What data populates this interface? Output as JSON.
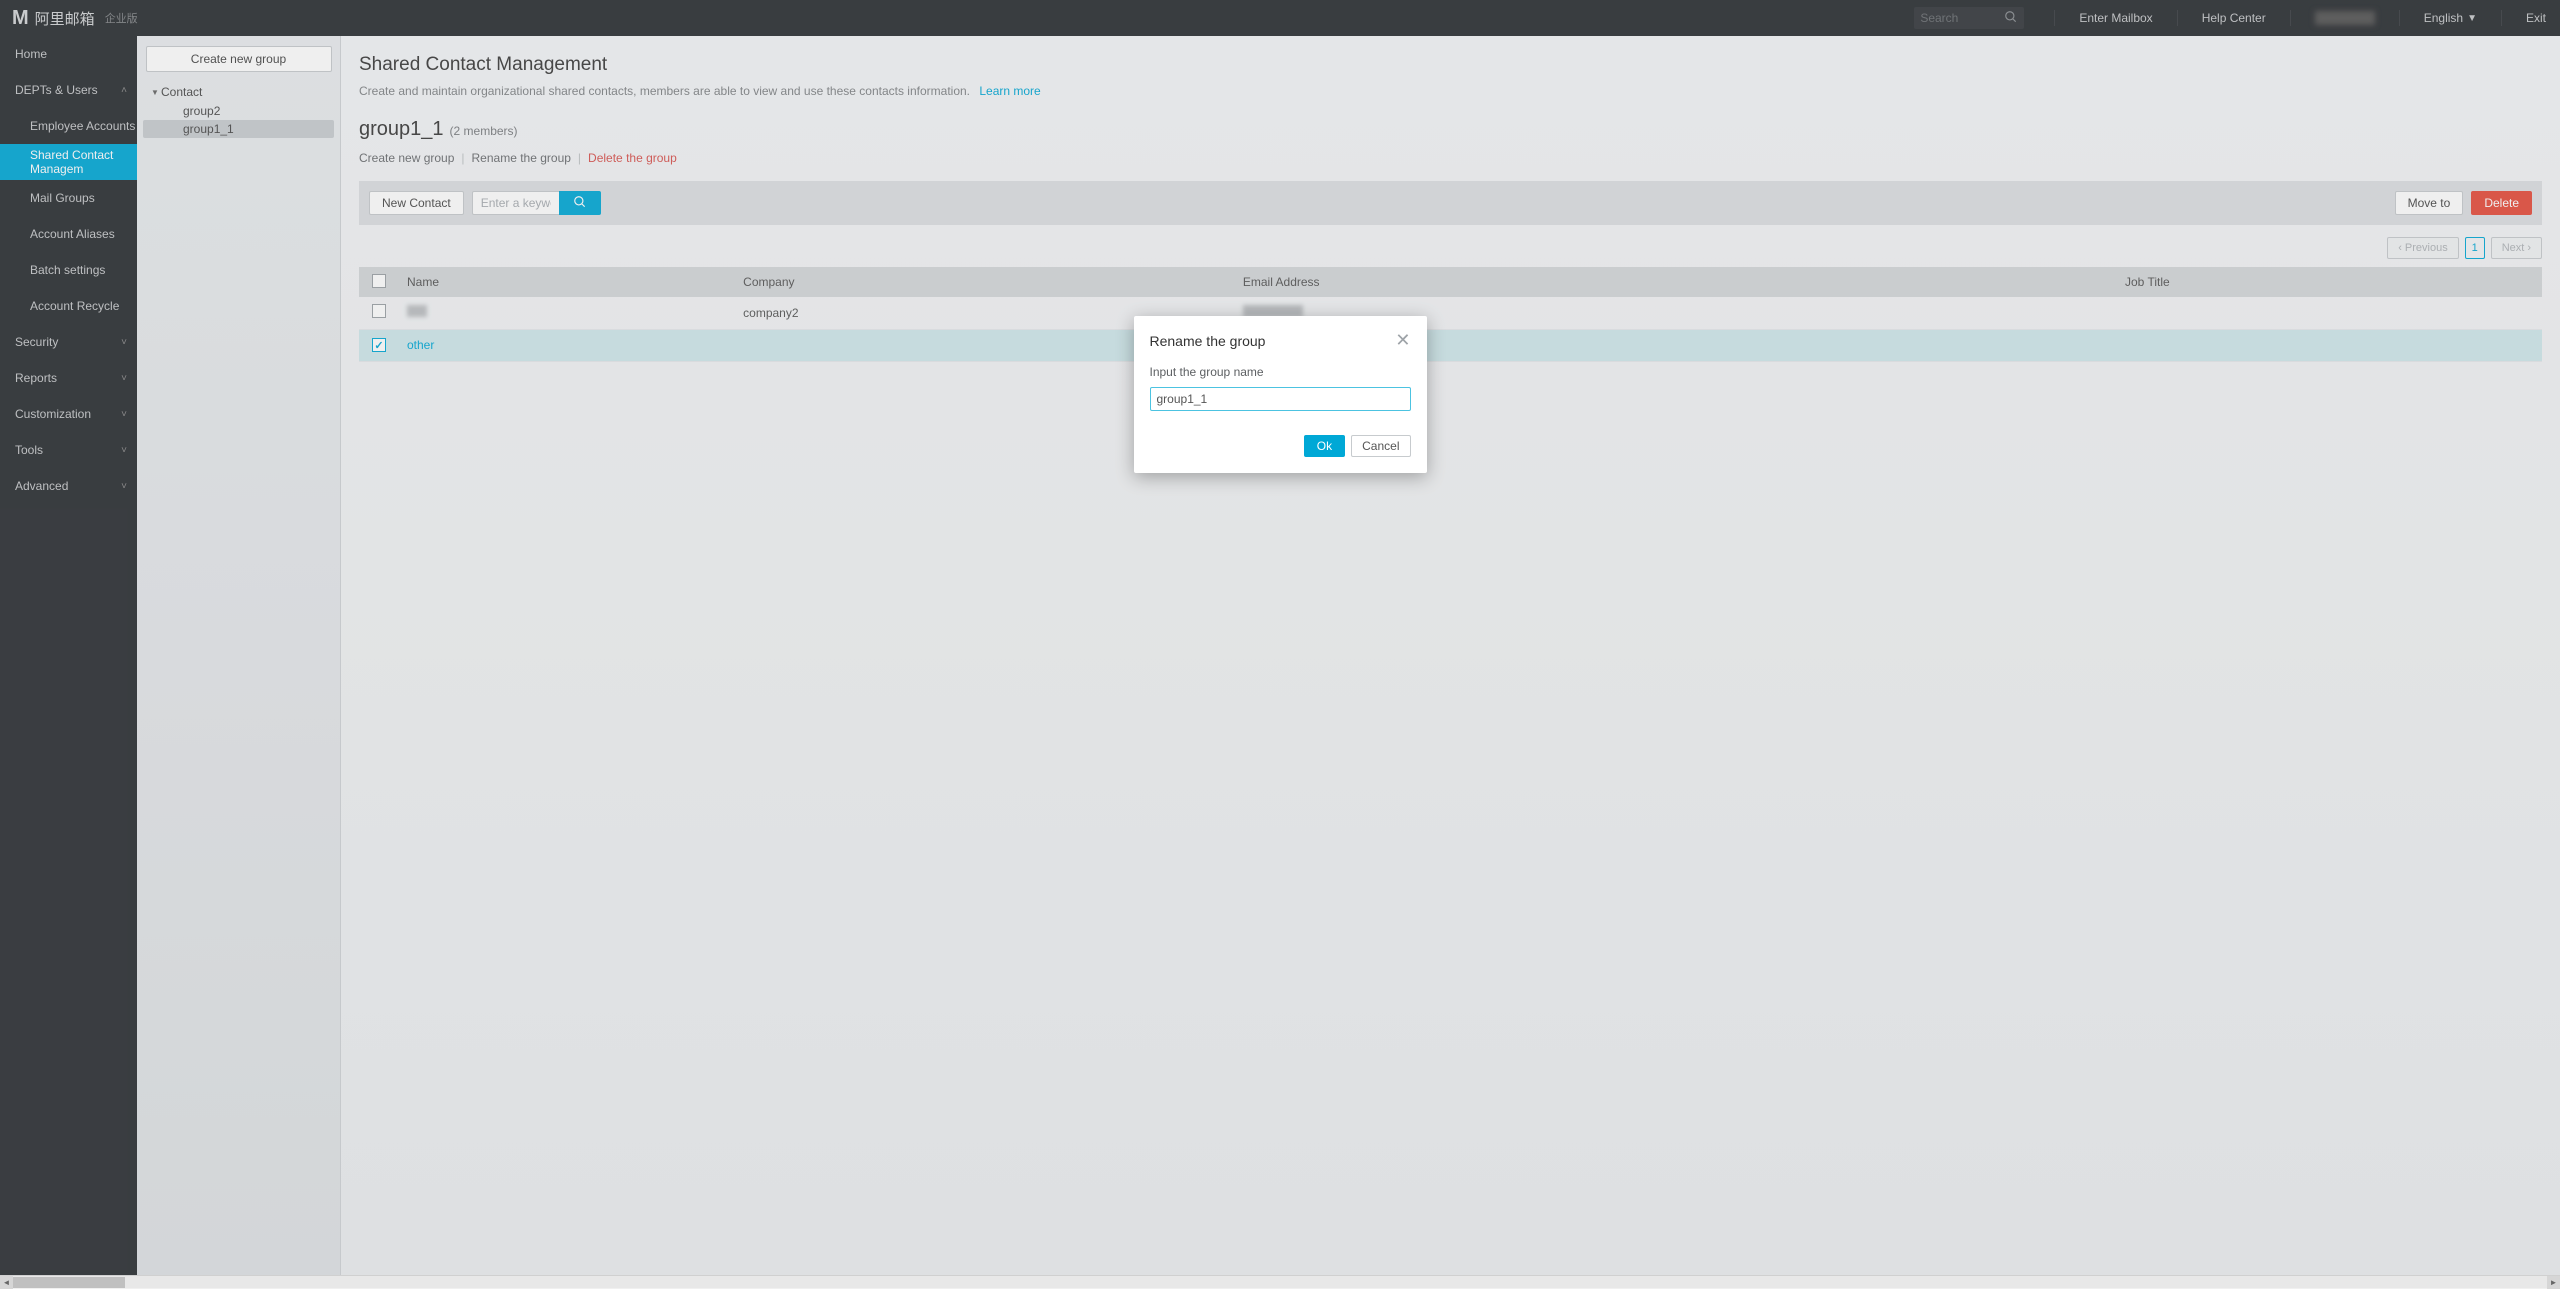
{
  "topbar": {
    "brand_cn": "阿里邮箱",
    "brand_sub": "企业版",
    "search_placeholder": "Search",
    "enter_mailbox": "Enter Mailbox",
    "help_center": "Help Center",
    "language": "English",
    "exit": "Exit"
  },
  "nav": {
    "home": "Home",
    "depts_users": "DEPTs & Users",
    "depts_children": {
      "employee_accounts": "Employee Accounts",
      "shared_contact_management": "Shared Contact Managem",
      "mail_groups": "Mail Groups",
      "account_aliases": "Account Aliases",
      "batch_settings": "Batch settings",
      "account_recycle": "Account Recycle"
    },
    "security": "Security",
    "reports": "Reports",
    "customization": "Customization",
    "tools": "Tools",
    "advanced": "Advanced"
  },
  "tree": {
    "create_button": "Create new group",
    "root": "Contact",
    "children": [
      "group2",
      "group1_1"
    ],
    "active_index": 1
  },
  "main": {
    "page_title": "Shared Contact Management",
    "page_desc": "Create and maintain organizational shared contacts, members are able to view and use these contacts information.",
    "learn_more": "Learn more",
    "group_name": "group1_1",
    "member_count_text": "(2 members)",
    "links": {
      "create": "Create new group",
      "rename": "Rename the group",
      "delete": "Delete the group"
    },
    "toolbar": {
      "new_contact": "New Contact",
      "keyword_placeholder": "Enter a keyword",
      "move_to": "Move to",
      "delete": "Delete"
    },
    "pager": {
      "previous": "Previous",
      "page": "1",
      "next": "Next"
    },
    "table": {
      "headers": {
        "name": "Name",
        "company": "Company",
        "email": "Email Address",
        "job": "Job Title"
      },
      "rows": [
        {
          "name": "(redacted)",
          "name_redacted": true,
          "company": "company2",
          "email": "(redacted)",
          "email_redacted": true,
          "job": "",
          "selected": false
        },
        {
          "name": "other",
          "name_redacted": false,
          "company": "",
          "email": "(redacted)",
          "email_redacted": true,
          "job": "",
          "selected": true
        }
      ]
    }
  },
  "modal": {
    "title": "Rename the group",
    "label": "Input the group name",
    "value": "group1_1",
    "ok": "Ok",
    "cancel": "Cancel"
  }
}
